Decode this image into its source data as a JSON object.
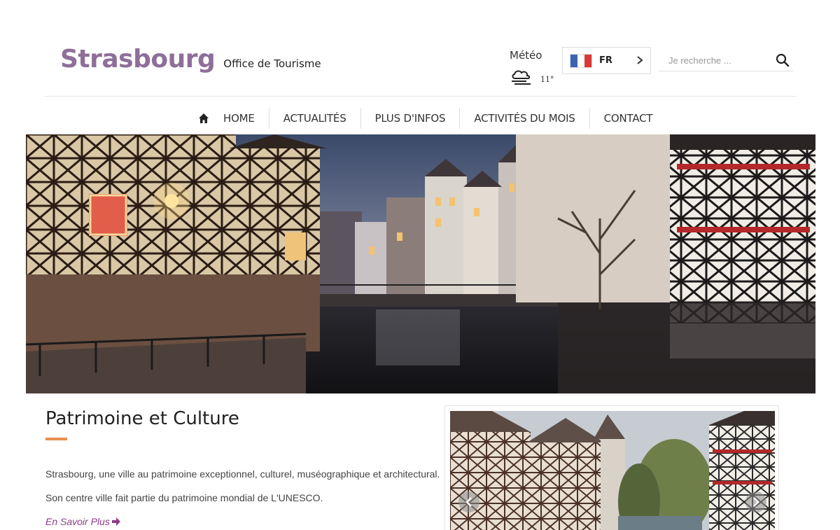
{
  "header": {
    "logo_title": "Strasbourg",
    "logo_subtitle": "Office de Tourisme",
    "meteo": {
      "label": "Météo",
      "temperature": "11°",
      "icon": "cloud-wind-icon"
    },
    "language": {
      "code": "FR",
      "flag_colors": [
        "#3c64b4",
        "#ffffff",
        "#d83a36"
      ]
    },
    "search": {
      "placeholder": "Je recherche ..."
    }
  },
  "nav": {
    "items": [
      {
        "label": "HOME"
      },
      {
        "label": "ACTUALITÉS"
      },
      {
        "label": "PLUS D'INFOS"
      },
      {
        "label": "ACTIVITÉS DU MOIS"
      },
      {
        "label": "CONTACT"
      }
    ]
  },
  "content": {
    "title": "Patrimoine et Culture",
    "paragraph_1": "Strasbourg, une ville au patrimoine exceptionnel, culturel, muséographique et architectural.",
    "paragraph_2": "Son centre ville fait partie du patrimoine mondial de L'UNESCO.",
    "more_link": "En Savoir Plus"
  },
  "colors": {
    "brand": "#8e6f99",
    "accent": "#e98e4d",
    "link": "#8e3c8a"
  }
}
